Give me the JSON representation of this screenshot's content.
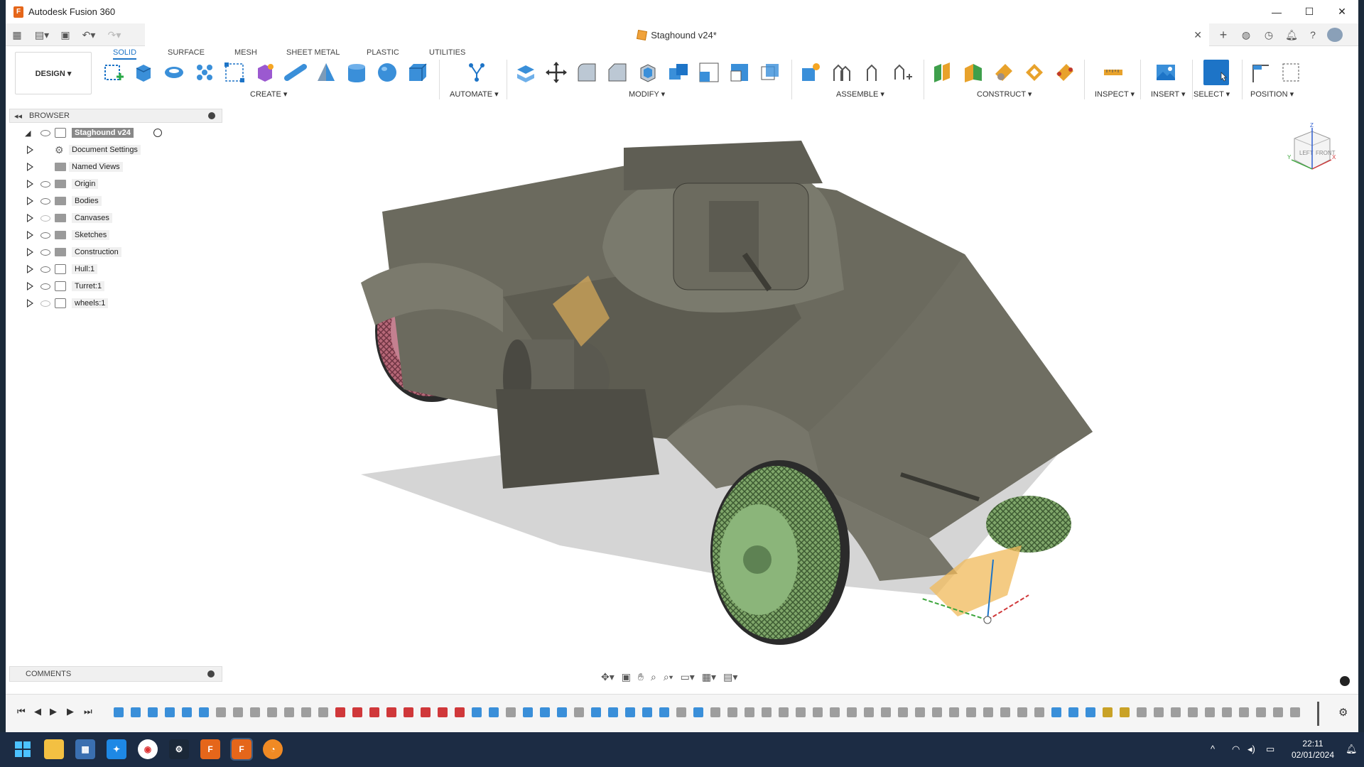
{
  "app": {
    "title": "Autodesk Fusion 360",
    "icon": "fusion-app-icon"
  },
  "window_controls": {
    "minimize": "—",
    "maximize": "☐",
    "close": "✕"
  },
  "document": {
    "tab_label": "Staghound v24*"
  },
  "workspace": {
    "label": "DESIGN ▾"
  },
  "ribbon": {
    "tabs": [
      "SOLID",
      "SURFACE",
      "MESH",
      "SHEET METAL",
      "PLASTIC",
      "UTILITIES"
    ],
    "active_tab": "SOLID",
    "groups": {
      "create": "CREATE ▾",
      "automate": "AUTOMATE ▾",
      "modify": "MODIFY ▾",
      "assemble": "ASSEMBLE ▾",
      "construct": "CONSTRUCT ▾",
      "inspect": "INSPECT ▾",
      "insert": "INSERT ▾",
      "select": "SELECT ▾",
      "position": "POSITION ▾"
    }
  },
  "browser": {
    "title": "BROWSER",
    "root": "Staghound v24",
    "items": [
      {
        "label": "Document Settings",
        "icon": "gear-icon",
        "eye": "none"
      },
      {
        "label": "Named Views",
        "icon": "folder-icon",
        "eye": "none"
      },
      {
        "label": "Origin",
        "icon": "folder-icon",
        "eye": "visible"
      },
      {
        "label": "Bodies",
        "icon": "folder-icon",
        "eye": "visible"
      },
      {
        "label": "Canvases",
        "icon": "folder-icon",
        "eye": "hidden"
      },
      {
        "label": "Sketches",
        "icon": "folder-icon",
        "eye": "visible"
      },
      {
        "label": "Construction",
        "icon": "folder-icon",
        "eye": "visible"
      },
      {
        "label": "Hull:1",
        "icon": "component-icon",
        "eye": "visible"
      },
      {
        "label": "Turret:1",
        "icon": "component-icon",
        "eye": "visible"
      },
      {
        "label": "wheels:1",
        "icon": "component-icon",
        "eye": "hidden"
      }
    ]
  },
  "comments": {
    "title": "COMMENTS"
  },
  "viewcube": {
    "left": "LEFT",
    "front": "FRONT",
    "z": "Z",
    "x": "X",
    "y": "Y"
  },
  "taskbar": {
    "time": "22:11",
    "date": "02/01/2024"
  },
  "colors": {
    "accent": "#1d74c7",
    "fusion_orange": "#e5661a",
    "body": "#6b6a5e",
    "wheel_pink": "#b66878",
    "wheel_green": "#7fa66a"
  }
}
